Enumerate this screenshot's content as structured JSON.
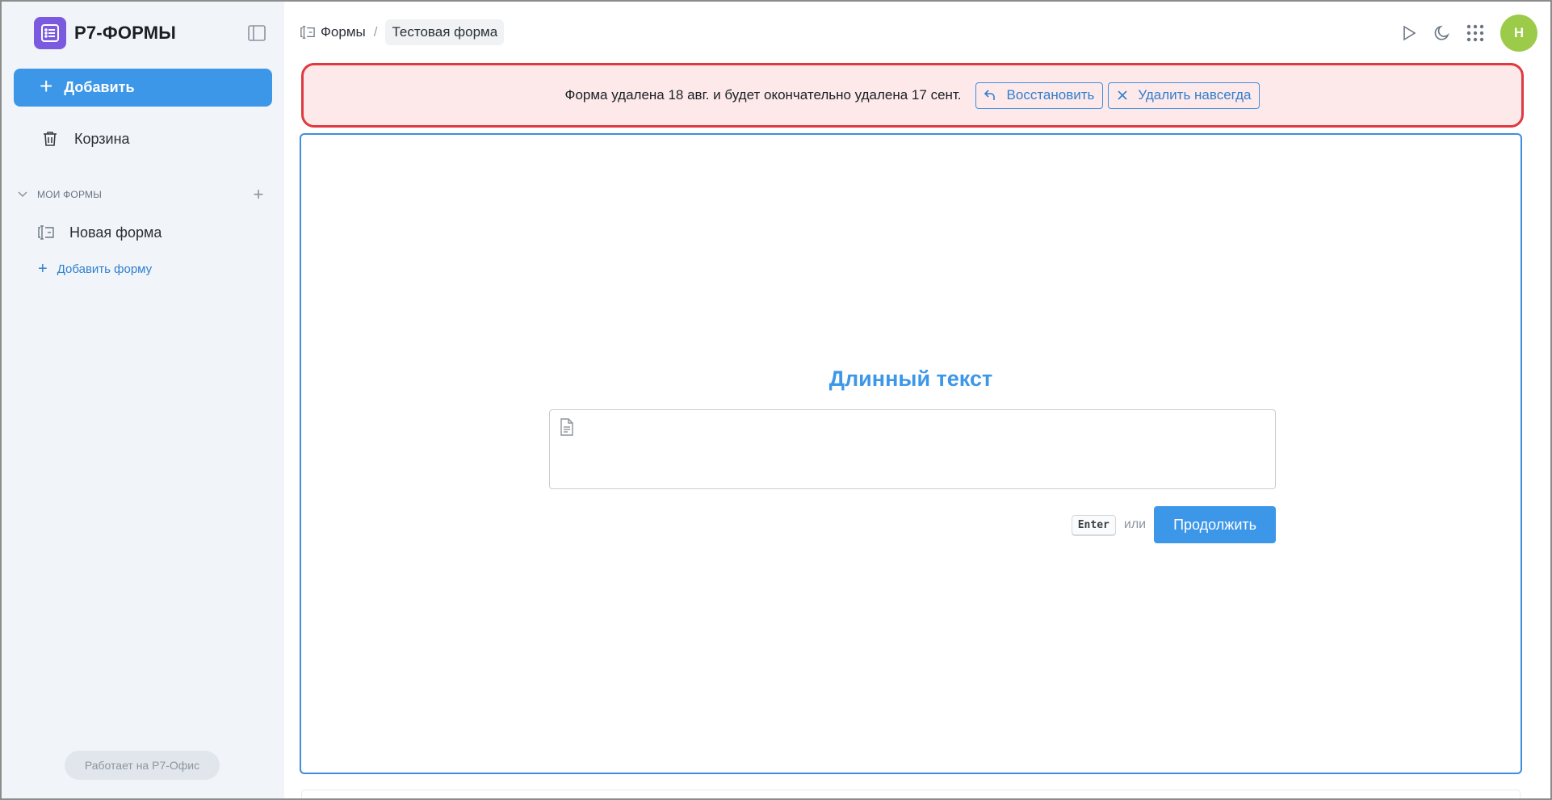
{
  "app": {
    "brand_name": "Р7-ФОРМЫ",
    "accent_color": "#3d97e8",
    "brand_color": "#7b5ae0"
  },
  "sidebar": {
    "add_label": "Добавить",
    "trash_label": "Корзина",
    "section_title": "МОИ ФОРМЫ",
    "forms": [
      {
        "label": "Новая форма",
        "icon": "form-icon"
      }
    ],
    "add_form_label": "Добавить форму",
    "powered_by": "Работает на Р7-Офис"
  },
  "header": {
    "breadcrumb": {
      "root": "Формы",
      "separator": "/",
      "current": "Тестовая форма"
    },
    "actions": [
      "play-icon",
      "moon-icon",
      "apps-grid-icon"
    ],
    "avatar_initial": "Н",
    "avatar_color": "#9ccb4a"
  },
  "alert": {
    "message": "Форма удалена 18 авг. и будет окончательно удалена 17 сент.",
    "restore_label": "Восстановить",
    "delete_forever_label": "Удалить навсегда",
    "border_color": "#de3a3f",
    "background_color": "#fde9ea"
  },
  "question": {
    "title": "Длинный текст",
    "textarea_value": "",
    "hint_key": "Enter",
    "hint_or": "или",
    "continue_label": "Продолжить"
  }
}
